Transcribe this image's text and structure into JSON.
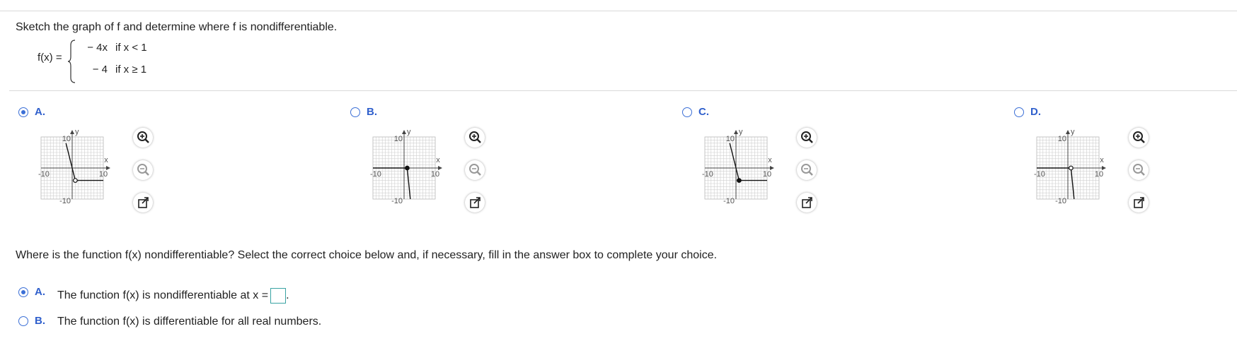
{
  "question": {
    "prompt": "Sketch the graph of f and determine where f is nondifferentiable.",
    "function_label": "f(x) =",
    "pieces": [
      {
        "expr": "− 4x",
        "cond": "if x < 1"
      },
      {
        "expr": "− 4",
        "cond": "if x ≥ 1"
      }
    ]
  },
  "graph_options": [
    {
      "letter": "A.",
      "selected": true
    },
    {
      "letter": "B.",
      "selected": false
    },
    {
      "letter": "C.",
      "selected": false
    },
    {
      "letter": "D.",
      "selected": false
    }
  ],
  "graph_axes": {
    "x_label": "x",
    "y_label": "y",
    "x_min_label": "-10",
    "x_max_label": "10",
    "y_max_label": "10",
    "y_min_label": "-10"
  },
  "followup": {
    "prompt": "Where is the function f(x) nondifferentiable? Select the correct choice below and, if necessary, fill in the answer box to complete your choice.",
    "choices": [
      {
        "letter": "A.",
        "text": "The function f(x) is nondifferentiable at x =",
        "selected": true,
        "has_box": true,
        "answer_value": "",
        "suffix": "."
      },
      {
        "letter": "B.",
        "text": "The function f(x) is differentiable for all real numbers.",
        "selected": false,
        "has_box": false
      }
    ]
  },
  "icons": {
    "zoom_in": "zoom-in-icon",
    "zoom_out": "zoom-out-icon",
    "popout": "popout-icon"
  },
  "colors": {
    "accent": "#2f5fcc",
    "radio": "#3b6fd6",
    "answer_box_border": "#39a3a3",
    "divider": "#d9d9d9"
  }
}
